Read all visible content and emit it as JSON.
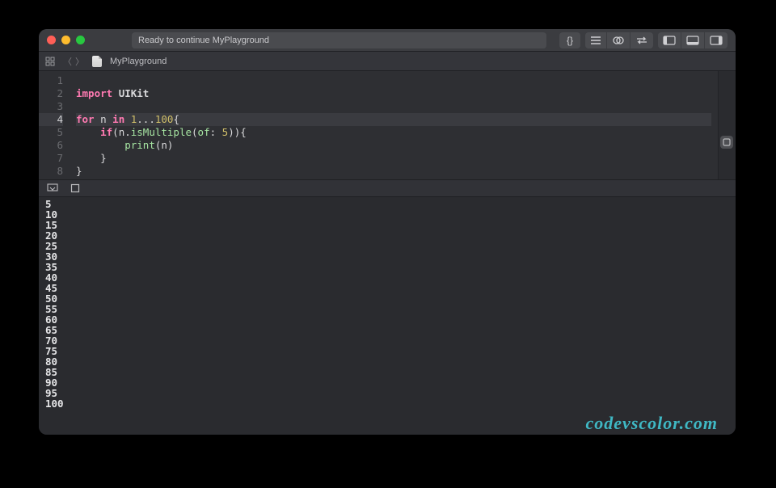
{
  "titlebar": {
    "status_text": "Ready to continue MyPlayground",
    "traffic": {
      "close": "close",
      "minimize": "minimize",
      "zoom": "zoom"
    }
  },
  "tabbar": {
    "filename": "MyPlayground"
  },
  "editor": {
    "highlighted_line": 4,
    "lines": [
      {
        "n": 1,
        "tokens": []
      },
      {
        "n": 2,
        "tokens": [
          {
            "t": "import ",
            "c": "kw"
          },
          {
            "t": "UIKit",
            "c": "type"
          }
        ]
      },
      {
        "n": 3,
        "tokens": []
      },
      {
        "n": 4,
        "tokens": [
          {
            "t": "for ",
            "c": "kw"
          },
          {
            "t": "n ",
            "c": "plain"
          },
          {
            "t": "in ",
            "c": "kw"
          },
          {
            "t": "1",
            "c": "num"
          },
          {
            "t": "...",
            "c": "plain"
          },
          {
            "t": "100",
            "c": "num"
          },
          {
            "t": "{",
            "c": "plain"
          }
        ]
      },
      {
        "n": 5,
        "tokens": [
          {
            "t": "    ",
            "c": "plain"
          },
          {
            "t": "if",
            "c": "kw"
          },
          {
            "t": "(n.",
            "c": "plain"
          },
          {
            "t": "isMultiple",
            "c": "fn"
          },
          {
            "t": "(",
            "c": "plain"
          },
          {
            "t": "of",
            "c": "fn"
          },
          {
            "t": ": ",
            "c": "plain"
          },
          {
            "t": "5",
            "c": "num"
          },
          {
            "t": ")){",
            "c": "plain"
          }
        ]
      },
      {
        "n": 6,
        "tokens": [
          {
            "t": "        ",
            "c": "plain"
          },
          {
            "t": "print",
            "c": "fn"
          },
          {
            "t": "(n)",
            "c": "plain"
          }
        ]
      },
      {
        "n": 7,
        "tokens": [
          {
            "t": "    }",
            "c": "plain"
          }
        ]
      },
      {
        "n": 8,
        "tokens": [
          {
            "t": "}",
            "c": "plain"
          }
        ]
      }
    ]
  },
  "console": {
    "output": [
      "5",
      "10",
      "15",
      "20",
      "25",
      "30",
      "35",
      "40",
      "45",
      "50",
      "55",
      "60",
      "65",
      "70",
      "75",
      "80",
      "85",
      "90",
      "95",
      "100"
    ]
  },
  "watermark": "codevscolor.com"
}
